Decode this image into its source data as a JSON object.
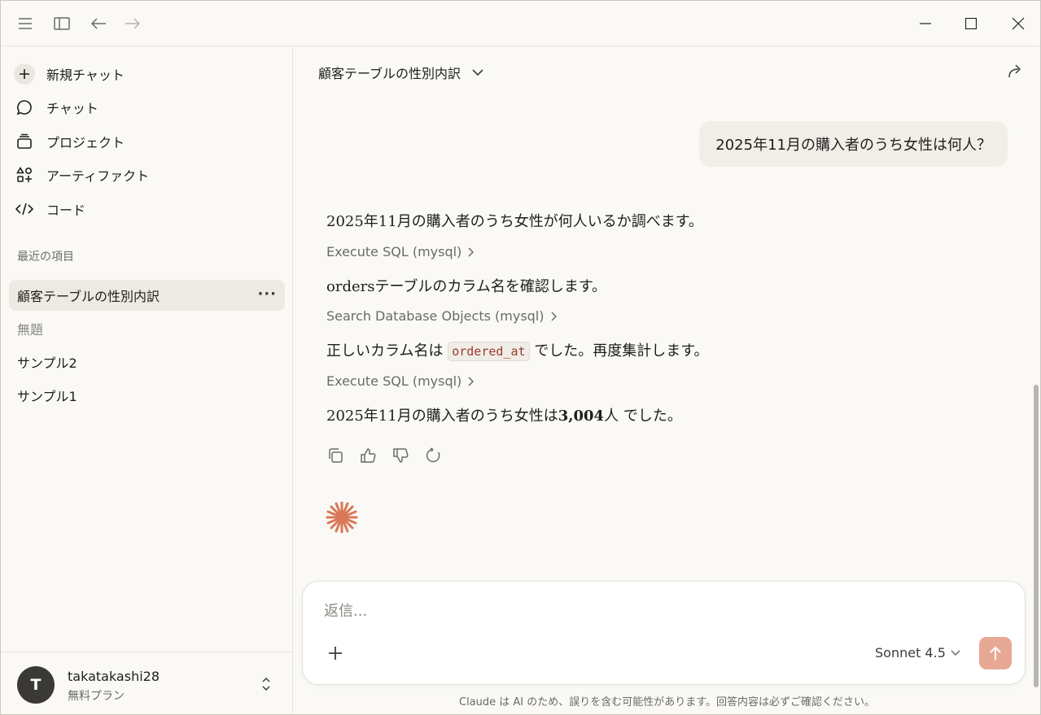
{
  "sidebar": {
    "nav": [
      {
        "label": "新規チャット",
        "icon": "plus-icon"
      },
      {
        "label": "チャット",
        "icon": "chat-bubble-icon"
      },
      {
        "label": "プロジェクト",
        "icon": "folder-stack-icon"
      },
      {
        "label": "アーティファクト",
        "icon": "artifacts-icon"
      },
      {
        "label": "コード",
        "icon": "code-icon"
      }
    ],
    "recent_label": "最近の項目",
    "recent": [
      {
        "label": "顧客テーブルの性別内訳",
        "active": true
      },
      {
        "label": "無題",
        "active": false
      },
      {
        "label": "サンプル2",
        "active": false
      },
      {
        "label": "サンプル1",
        "active": false
      }
    ],
    "user": {
      "initial": "T",
      "name": "takatakashi28",
      "plan": "無料プラン"
    }
  },
  "main": {
    "title": "顧客テーブルの性別内訳",
    "user_message": "2025年11月の購入者のうち女性は何人？",
    "assistant": {
      "line1": "2025年11月の購入者のうち女性が何人いるか調べます。",
      "tool1": "Execute SQL (mysql)",
      "line2_bold": "orders",
      "line2_rest": "テーブルのカラム名を確認します。",
      "tool2": "Search Database Objects (mysql)",
      "line3_pre": "正しいカラム名は",
      "line3_code": "ordered_at",
      "line3_post": "でした。再度集計します。",
      "tool3": "Execute SQL (mysql)",
      "line4_pre": "2025年11月の購入者のうち女性は",
      "line4_bold": "3,004",
      "line4_post": "人 でした。"
    }
  },
  "composer": {
    "placeholder": "返信...",
    "model": "Sonnet 4.5"
  },
  "disclaimer": "Claude は AI のため、誤りを含む可能性があります。回答内容は必ずご確認ください。",
  "colors": {
    "accent": "#d97757",
    "send_button": "#e8a994",
    "background": "#faf9f5"
  }
}
